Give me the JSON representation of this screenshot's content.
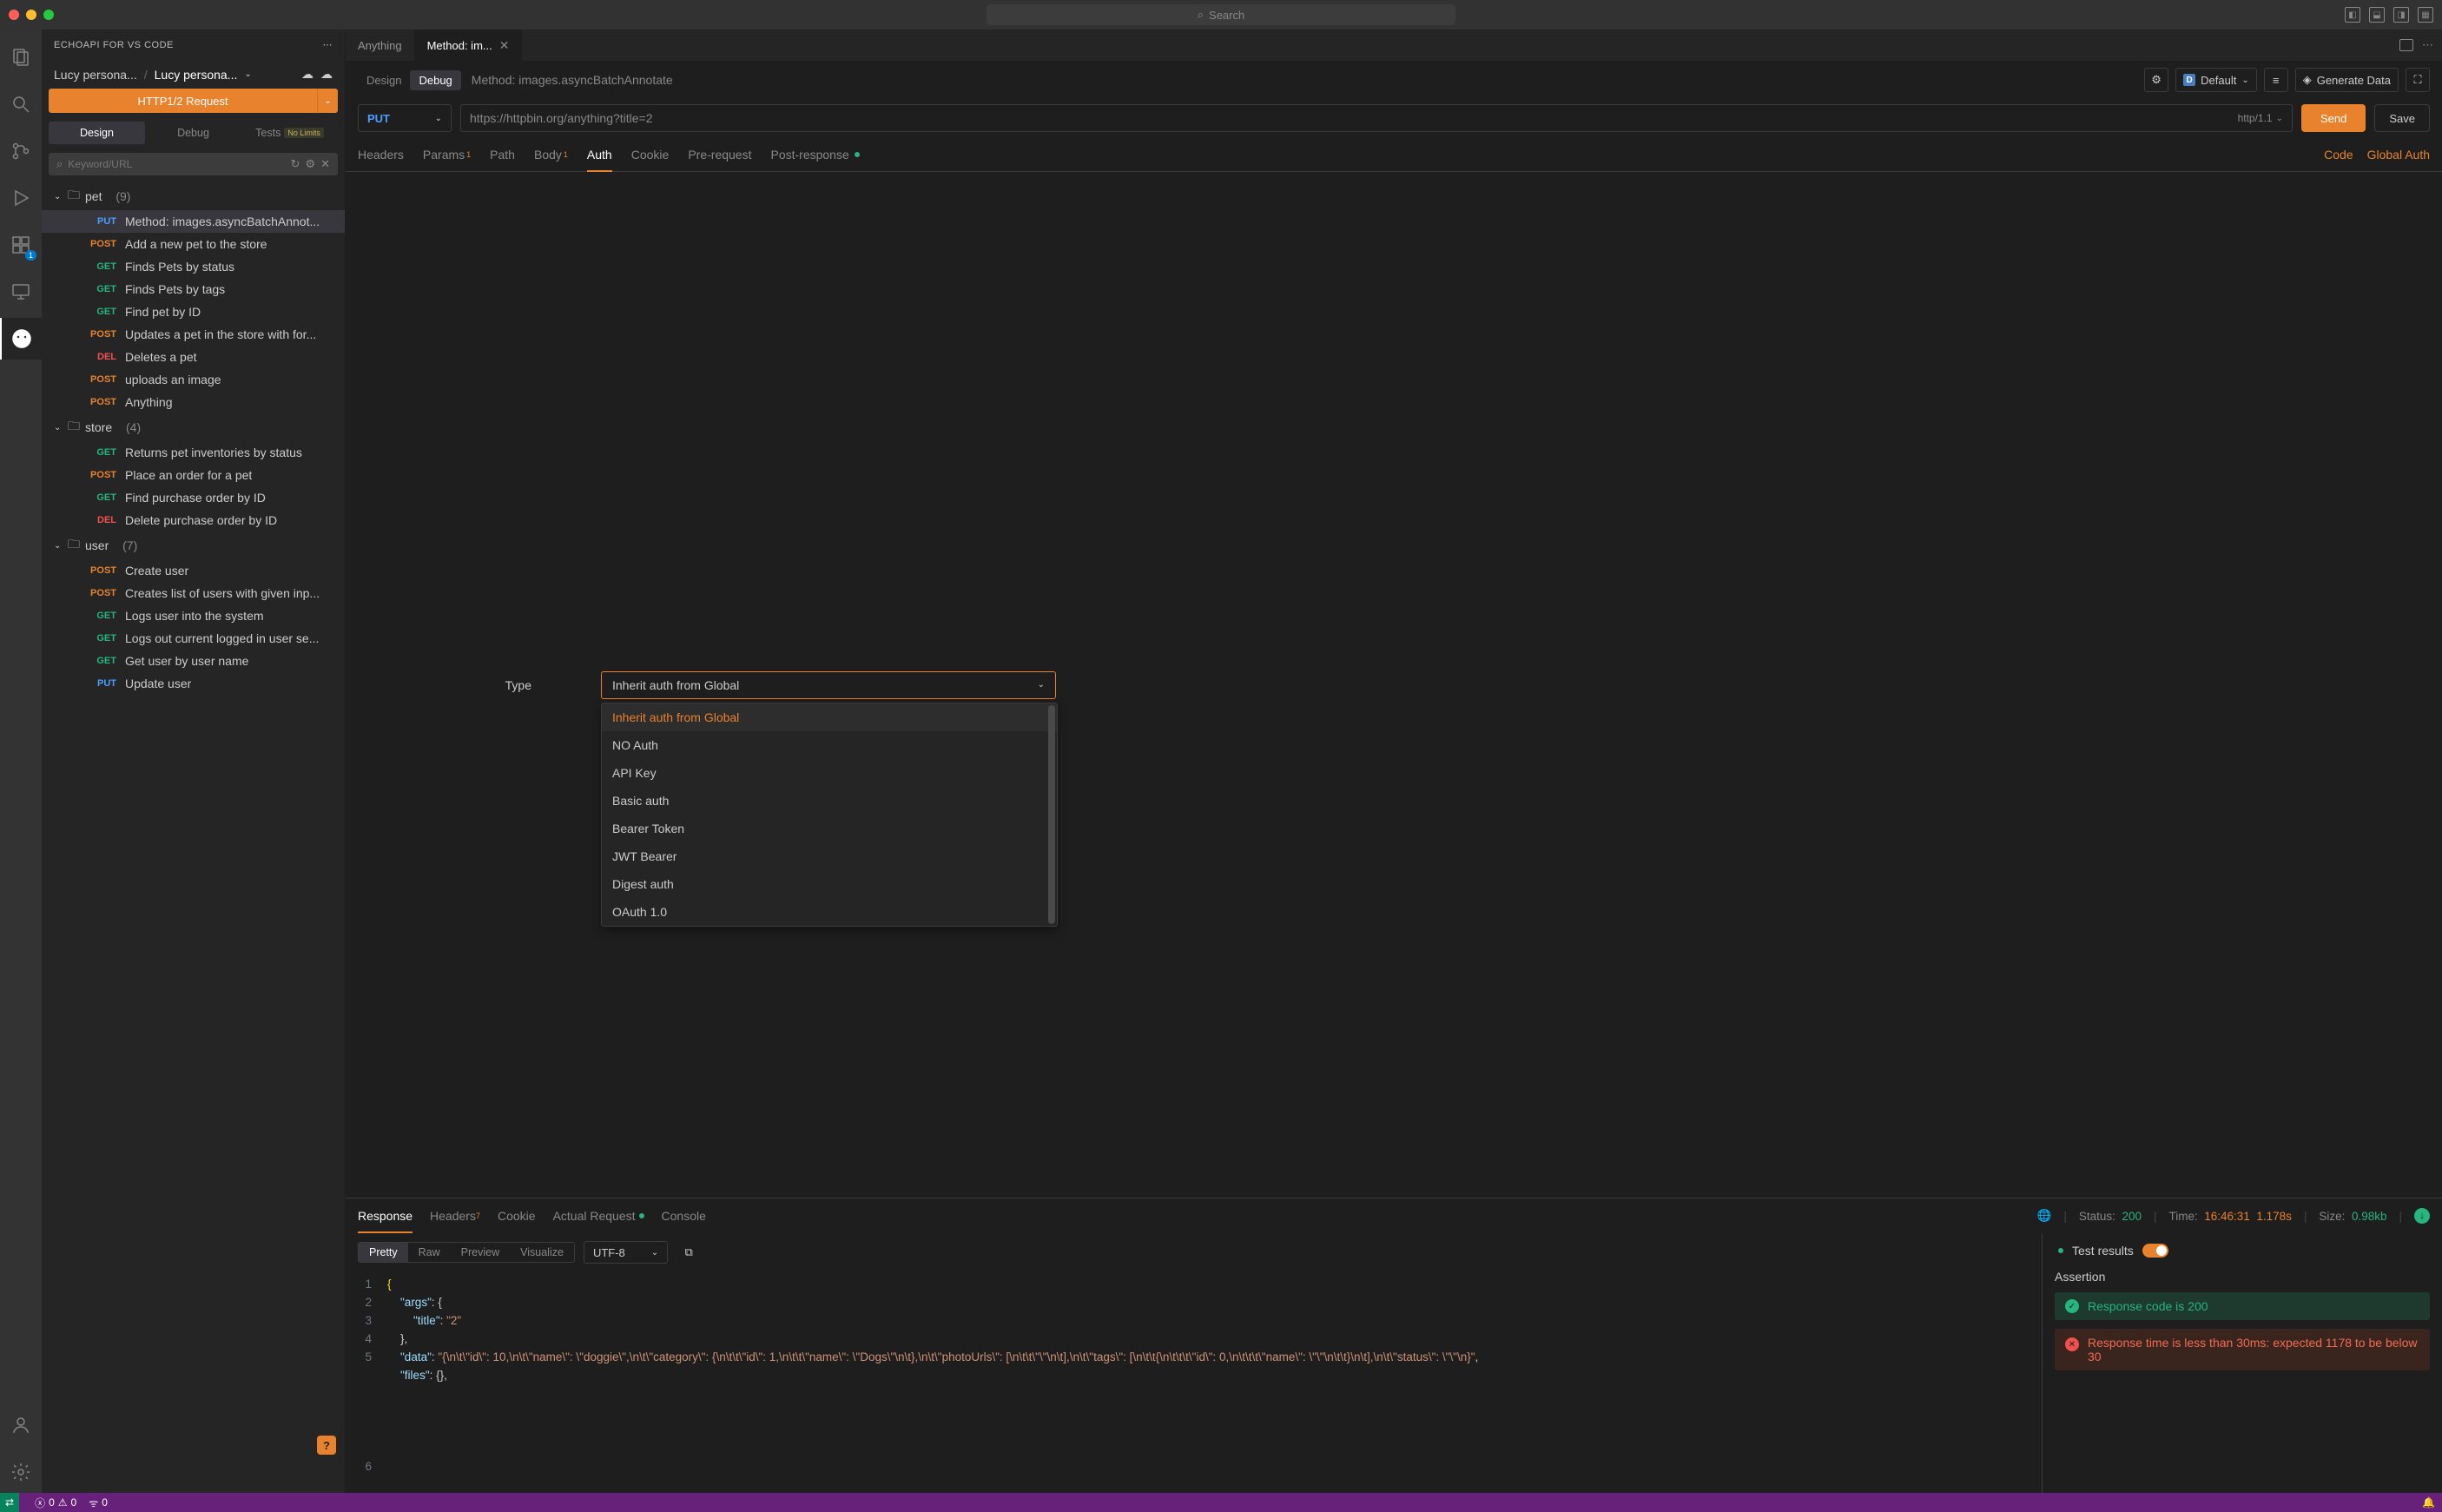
{
  "titlebar": {
    "search_placeholder": "Search"
  },
  "sidebar": {
    "title": "ECHOAPI FOR VS CODE",
    "crumb1": "Lucy persona...",
    "crumb2": "Lucy persona...",
    "http_button": "HTTP1/2 Request",
    "tabs": {
      "design": "Design",
      "debug": "Debug",
      "tests": "Tests",
      "no_limits": "No Limits"
    },
    "search_placeholder": "Keyword/URL",
    "folders": [
      {
        "name": "pet",
        "count": "(9)",
        "items": [
          {
            "method": "PUT",
            "name": "Method: images.asyncBatchAnnot...",
            "active": true
          },
          {
            "method": "POST",
            "name": "Add a new pet to the store"
          },
          {
            "method": "GET",
            "name": "Finds Pets by status"
          },
          {
            "method": "GET",
            "name": "Finds Pets by tags"
          },
          {
            "method": "GET",
            "name": "Find pet by ID"
          },
          {
            "method": "POST",
            "name": "Updates a pet in the store with for..."
          },
          {
            "method": "DEL",
            "name": "Deletes a pet"
          },
          {
            "method": "POST",
            "name": "uploads an image"
          },
          {
            "method": "POST",
            "name": "Anything"
          }
        ]
      },
      {
        "name": "store",
        "count": "(4)",
        "items": [
          {
            "method": "GET",
            "name": "Returns pet inventories by status"
          },
          {
            "method": "POST",
            "name": "Place an order for a pet"
          },
          {
            "method": "GET",
            "name": "Find purchase order by ID"
          },
          {
            "method": "DEL",
            "name": "Delete purchase order by ID"
          }
        ]
      },
      {
        "name": "user",
        "count": "(7)",
        "items": [
          {
            "method": "POST",
            "name": "Create user"
          },
          {
            "method": "POST",
            "name": "Creates list of users with given inp..."
          },
          {
            "method": "GET",
            "name": "Logs user into the system"
          },
          {
            "method": "GET",
            "name": "Logs out current logged in user se..."
          },
          {
            "method": "GET",
            "name": "Get user by user name"
          },
          {
            "method": "PUT",
            "name": "Update user"
          }
        ]
      }
    ]
  },
  "editor": {
    "tabs": [
      {
        "label": "Anything",
        "active": false
      },
      {
        "label": "Method: im...",
        "active": true
      }
    ],
    "mode": {
      "design": "Design",
      "debug": "Debug"
    },
    "title": "Method: images.asyncBatchAnnotate",
    "env_label": "Default",
    "gen_label": "Generate Data",
    "method": "PUT",
    "url": "https://httpbin.org/anything?title=2",
    "protocol": "http/1.1",
    "send": "Send",
    "save": "Save",
    "req_tabs": {
      "headers": "Headers",
      "params": "Params",
      "params_count": "1",
      "path": "Path",
      "body": "Body",
      "body_count": "1",
      "auth": "Auth",
      "cookie": "Cookie",
      "pre": "Pre-request",
      "post": "Post-response"
    },
    "code_link": "Code",
    "global_auth_link": "Global Auth",
    "auth": {
      "type_label": "Type",
      "selected": "Inherit auth from Global",
      "options": [
        "Inherit auth from Global",
        "NO Auth",
        "API Key",
        "Basic auth",
        "Bearer Token",
        "JWT Bearer",
        "Digest auth",
        "OAuth 1.0"
      ]
    }
  },
  "response": {
    "tabs": {
      "response": "Response",
      "headers": "Headers",
      "headers_count": "7",
      "cookie": "Cookie",
      "actual": "Actual Request",
      "console": "Console"
    },
    "status_label": "Status:",
    "status_code": "200",
    "time_label": "Time:",
    "time_val1": "16:46:31",
    "time_val2": "1.178s",
    "size_label": "Size:",
    "size_val": "0.98kb",
    "view_modes": {
      "pretty": "Pretty",
      "raw": "Raw",
      "preview": "Preview",
      "visualize": "Visualize"
    },
    "encoding": "UTF-8",
    "code": {
      "l1": "{",
      "l2a": "\"args\"",
      "l2b": ": {",
      "l3a": "\"title\"",
      "l3b": ": ",
      "l3c": "\"2\"",
      "l4": "},",
      "l5a": "\"data\"",
      "l5b": ": ",
      "l5c": "\"{\\n\\t\\\"id\\\": 10,\\n\\t\\\"name\\\": \\\"doggie\\\",\\n\\t\\\"category\\\": {\\n\\t\\t\\\"id\\\": 1,\\n\\t\\t\\\"name\\\": \\\"Dogs\\\"\\n\\t},\\n\\t\\\"photoUrls\\\": [\\n\\t\\t\\\"\\\"\\n\\t],\\n\\t\\\"tags\\\": [\\n\\t\\t{\\n\\t\\t\\t\\\"id\\\": 0,\\n\\t\\t\\t\\\"name\\\": \\\"\\\"\\n\\t\\t}\\n\\t],\\n\\t\\\"status\\\": \\\"\\\"\\n}\"",
      "l5d": ",",
      "l6a": "\"files\"",
      "l6b": ": {},"
    },
    "test_results": "Test results",
    "assertion_label": "Assertion",
    "assert_pass": "Response code is 200",
    "assert_fail": "Response time is less than 30ms: expected 1178 to be below 30"
  },
  "statusbar": {
    "errors": "0",
    "warnings": "0",
    "ports": "0"
  }
}
